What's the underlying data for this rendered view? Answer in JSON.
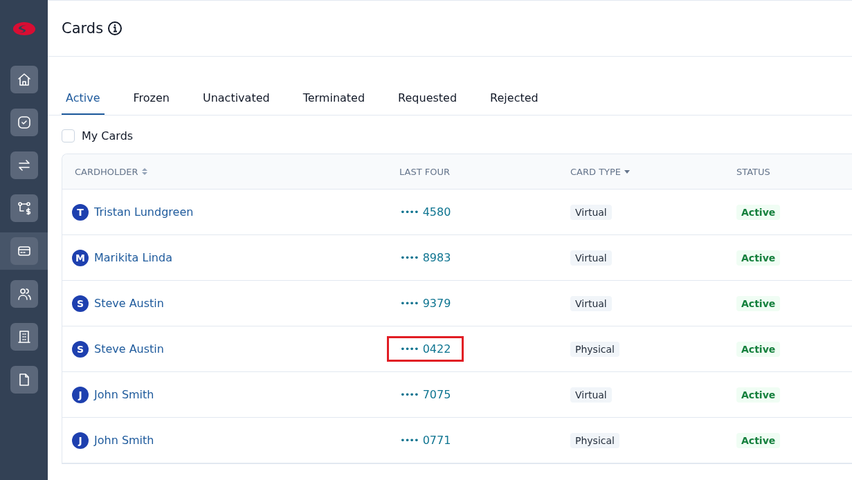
{
  "page": {
    "title": "Cards"
  },
  "sidebar": {
    "items": [
      {
        "kind": "home",
        "selected": false
      },
      {
        "kind": "tasks",
        "selected": false
      },
      {
        "kind": "transfers",
        "selected": false
      },
      {
        "kind": "payments",
        "selected": false
      },
      {
        "kind": "cards",
        "selected": true
      },
      {
        "kind": "people",
        "selected": false
      },
      {
        "kind": "building",
        "selected": false
      },
      {
        "kind": "document",
        "selected": false
      }
    ]
  },
  "tabs": [
    {
      "label": "Active",
      "selected": true
    },
    {
      "label": "Frozen",
      "selected": false
    },
    {
      "label": "Unactivated",
      "selected": false
    },
    {
      "label": "Terminated",
      "selected": false
    },
    {
      "label": "Requested",
      "selected": false
    },
    {
      "label": "Rejected",
      "selected": false
    }
  ],
  "filter": {
    "label": "My Cards",
    "checked": false
  },
  "table": {
    "columns": [
      {
        "label": "CARDHOLDER",
        "kind": "sortable"
      },
      {
        "label": "LAST FOUR",
        "kind": "plain"
      },
      {
        "label": "CARD TYPE",
        "kind": "filter"
      },
      {
        "label": "STATUS",
        "kind": "plain"
      }
    ],
    "rows": [
      {
        "initial": "T",
        "name": "Tristan Lundgreen",
        "dots": "••••",
        "last_four": "4580",
        "card_type": "Virtual",
        "status": "Active",
        "highlighted": false
      },
      {
        "initial": "M",
        "name": "Marikita Linda",
        "dots": "••••",
        "last_four": "8983",
        "card_type": "Virtual",
        "status": "Active",
        "highlighted": false
      },
      {
        "initial": "S",
        "name": "Steve Austin",
        "dots": "••••",
        "last_four": "9379",
        "card_type": "Virtual",
        "status": "Active",
        "highlighted": false
      },
      {
        "initial": "S",
        "name": "Steve Austin",
        "dots": "••••",
        "last_four": "0422",
        "card_type": "Physical",
        "status": "Active",
        "highlighted": true
      },
      {
        "initial": "J",
        "name": "John Smith",
        "dots": "••••",
        "last_four": "7075",
        "card_type": "Virtual",
        "status": "Active",
        "highlighted": false
      },
      {
        "initial": "J",
        "name": "John Smith",
        "dots": "••••",
        "last_four": "0771",
        "card_type": "Physical",
        "status": "Active",
        "highlighted": false
      }
    ]
  }
}
